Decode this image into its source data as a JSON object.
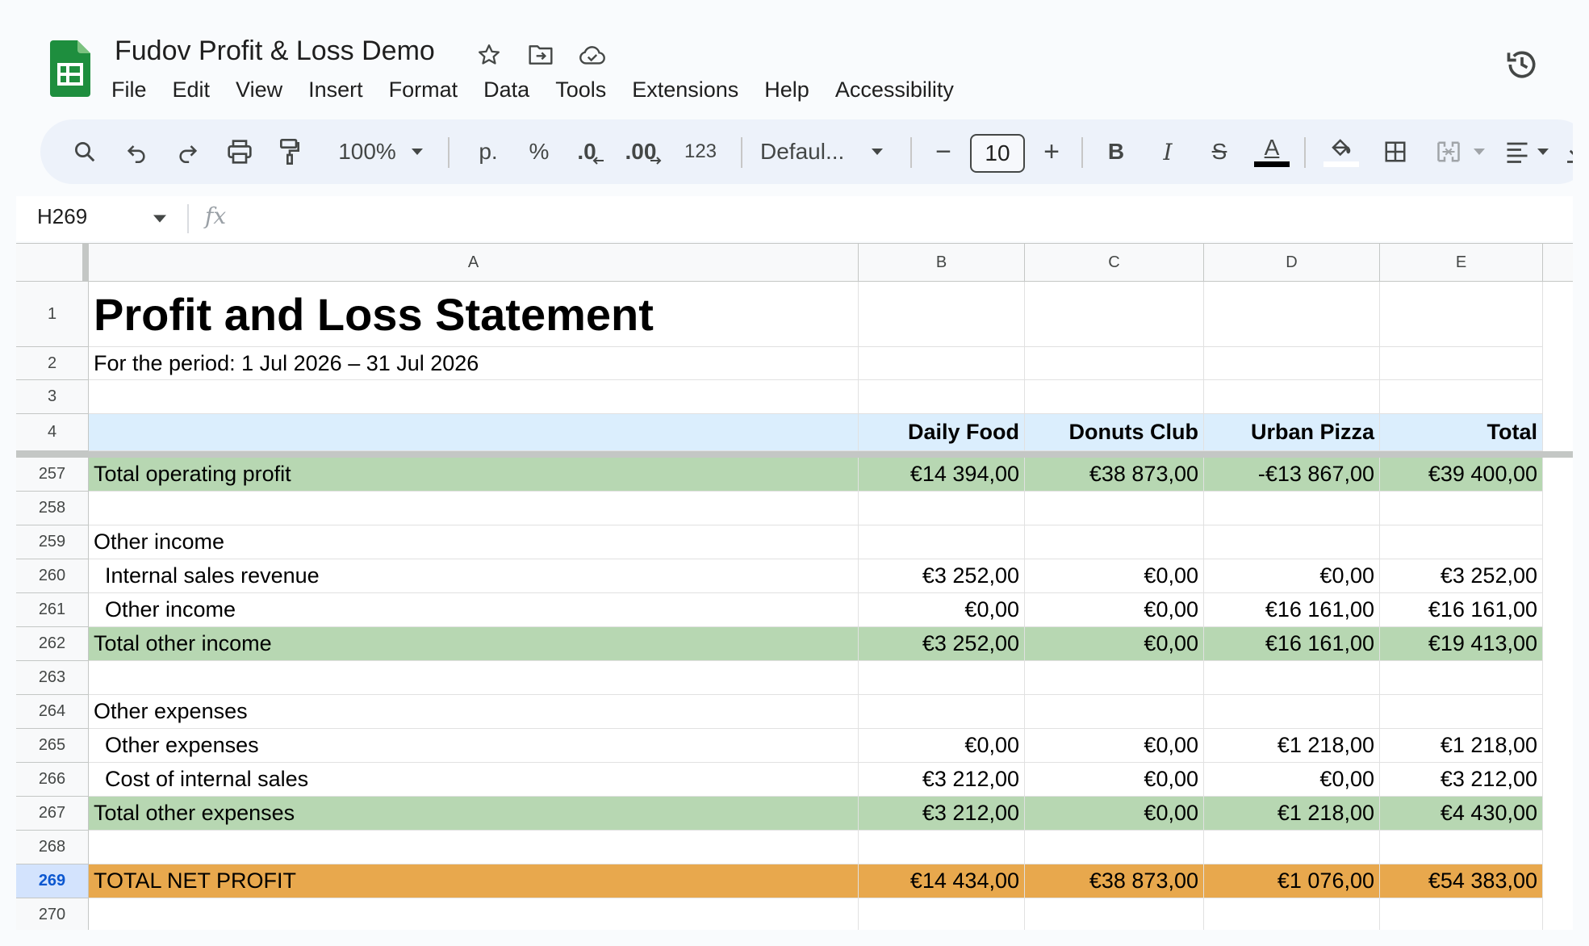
{
  "app": {
    "title": "Fudov Profit & Loss Demo",
    "menu": [
      "File",
      "Edit",
      "View",
      "Insert",
      "Format",
      "Data",
      "Tools",
      "Extensions",
      "Help",
      "Accessibility"
    ]
  },
  "toolbar": {
    "zoom": "100%",
    "currency_format": "p.",
    "percent_format": "%",
    "decrease_decimals": ".0",
    "increase_decimals": ".00",
    "number_format": "123",
    "font": "Defaul...",
    "font_size": "10",
    "minus": "−",
    "plus": "+",
    "bold": "B",
    "italic": "I",
    "strikethrough": "S",
    "text_color_label": "A",
    "text_color": "#000000"
  },
  "formula_bar": {
    "cell_ref": "H269",
    "fx": "fx",
    "content": ""
  },
  "columns": [
    "A",
    "B",
    "C",
    "D",
    "E"
  ],
  "sheet": {
    "title": "Profit and Loss Statement",
    "period": "For the period: 1 Jul 2026 – 31 Jul 2026",
    "headers": [
      "Daily Food",
      "Donuts Club",
      "Urban Pizza",
      "Total"
    ],
    "rows": [
      {
        "num": "257",
        "label": "Total operating profit",
        "values": [
          "€14 394,00",
          "€38 873,00",
          "-€13 867,00",
          "€39 400,00"
        ],
        "style": "green"
      },
      {
        "num": "258",
        "label": "",
        "values": [
          "",
          "",
          "",
          ""
        ],
        "style": "plain"
      },
      {
        "num": "259",
        "label": "Other income",
        "values": [
          "",
          "",
          "",
          ""
        ],
        "style": "plain"
      },
      {
        "num": "260",
        "label": "Internal sales revenue",
        "values": [
          "€3 252,00",
          "€0,00",
          "€0,00",
          "€3 252,00"
        ],
        "style": "indent"
      },
      {
        "num": "261",
        "label": "Other income",
        "values": [
          "€0,00",
          "€0,00",
          "€16 161,00",
          "€16 161,00"
        ],
        "style": "indent"
      },
      {
        "num": "262",
        "label": "Total other income",
        "values": [
          "€3 252,00",
          "€0,00",
          "€16 161,00",
          "€19 413,00"
        ],
        "style": "green"
      },
      {
        "num": "263",
        "label": "",
        "values": [
          "",
          "",
          "",
          ""
        ],
        "style": "plain"
      },
      {
        "num": "264",
        "label": "Other expenses",
        "values": [
          "",
          "",
          "",
          ""
        ],
        "style": "plain"
      },
      {
        "num": "265",
        "label": "Other expenses",
        "values": [
          "€0,00",
          "€0,00",
          "€1 218,00",
          "€1 218,00"
        ],
        "style": "indent"
      },
      {
        "num": "266",
        "label": "Cost of internal sales",
        "values": [
          "€3 212,00",
          "€0,00",
          "€0,00",
          "€3 212,00"
        ],
        "style": "indent"
      },
      {
        "num": "267",
        "label": "Total other expenses",
        "values": [
          "€3 212,00",
          "€0,00",
          "€1 218,00",
          "€4 430,00"
        ],
        "style": "green"
      },
      {
        "num": "268",
        "label": "",
        "values": [
          "",
          "",
          "",
          ""
        ],
        "style": "plain"
      },
      {
        "num": "269",
        "label": "TOTAL NET PROFIT",
        "values": [
          "€14 434,00",
          "€38 873,00",
          "€1 076,00",
          "€54 383,00"
        ],
        "style": "orange",
        "selected": true
      },
      {
        "num": "270",
        "label": "",
        "values": [
          "",
          "",
          "",
          ""
        ],
        "style": "plain"
      }
    ],
    "frozen_row_nums": [
      "1",
      "2",
      "3",
      "4"
    ]
  },
  "colors": {
    "subtotal_fill": "#b7d7b2",
    "net_profit_fill": "#e8a84d",
    "header_fill": "#dbeefd",
    "sheets_green": "#1e8e3e"
  }
}
